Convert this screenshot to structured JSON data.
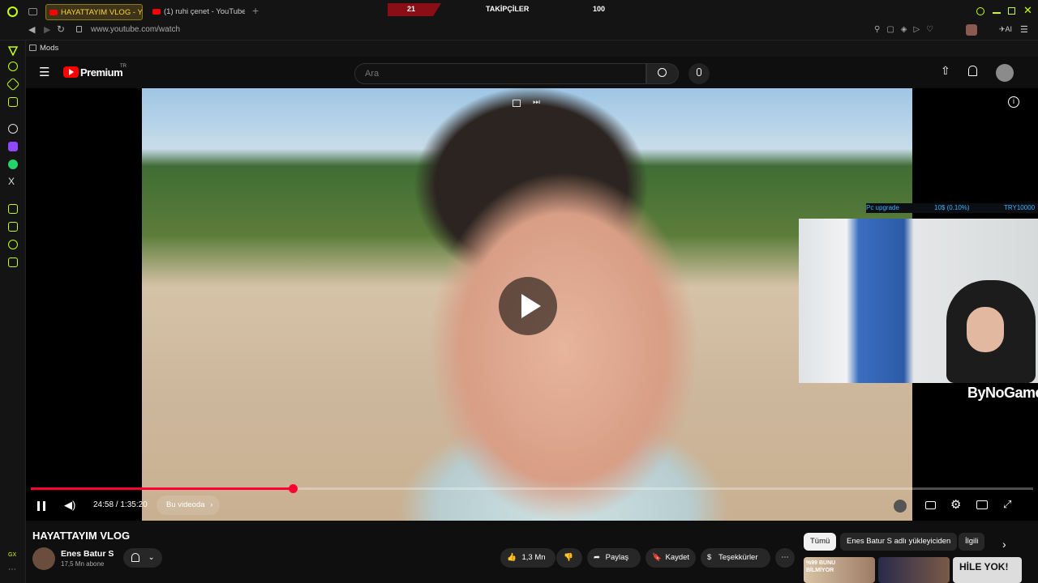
{
  "browser": {
    "tabs": [
      {
        "label": "HAYATTAYIM VLOG - You"
      },
      {
        "label": "(1) ruhi çenet - YouTube"
      }
    ],
    "url": "www.youtube.com/watch",
    "bookmark": "Mods",
    "overlay_counter": {
      "left": "21",
      "label": "TAKİPÇİLER",
      "right": "100"
    }
  },
  "youtube": {
    "logo_text": "Premium",
    "region": "TR",
    "search_placeholder": "Ara",
    "player": {
      "progress": 0.2616,
      "current_time": "24:58",
      "duration": "1:35:20",
      "time_text": "24:58 / 1:35:20",
      "chapter_chip": "Bu videoda"
    },
    "stream_overlay": {
      "pc": "Pc upgrade",
      "amount": "10$ (0.10%)",
      "goal": "TRY10000",
      "brand": "ByNoGame"
    },
    "video": {
      "title": "HAYATTAYIM VLOG",
      "channel": "Enes Batur S",
      "subscribers": "17,5 Mn abone",
      "likes": "1,3 Mn",
      "share": "Paylaş",
      "save": "Kaydet",
      "thanks": "Teşekkürler"
    },
    "related_chips": [
      "Tümü",
      "Enes Batur S adlı yükleyiciden",
      "İlgili"
    ],
    "thumb_texts": [
      "%99 BUNU BİLMİYOR",
      "HİLE YOK!"
    ]
  }
}
